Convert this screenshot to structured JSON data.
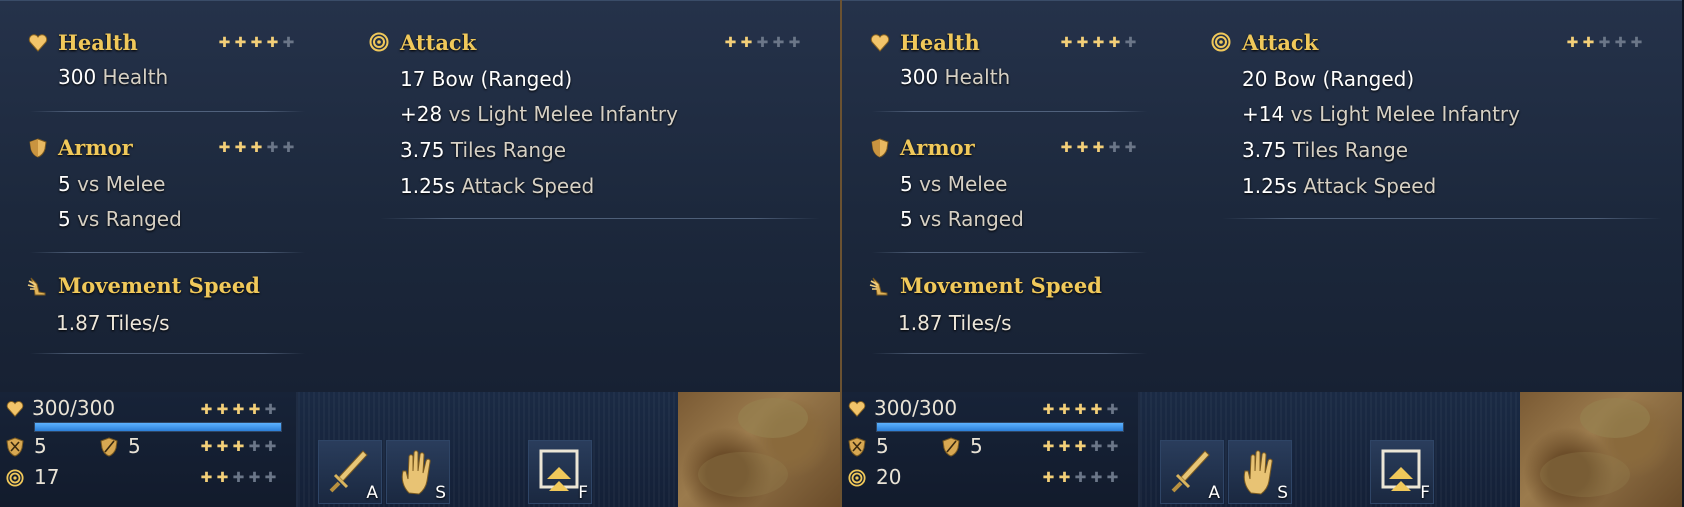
{
  "left": {
    "tooltip": {
      "health": {
        "title": "Health",
        "value": "300",
        "label": "Health",
        "rating": 4
      },
      "armor": {
        "title": "Armor",
        "rating": 3,
        "melee_value": "5",
        "melee_label": "vs Melee",
        "ranged_value": "5",
        "ranged_label": "vs Ranged"
      },
      "movement": {
        "title": "Movement Speed",
        "value": "1.87 Tiles/s"
      },
      "attack": {
        "title": "Attack",
        "rating": 2,
        "lines": [
          {
            "value": "17 Bow (Ranged)",
            "label": ""
          },
          {
            "value": "+28",
            "label": "vs Light Melee Infantry"
          },
          {
            "value": "3.75",
            "label": "Tiles Range"
          },
          {
            "value": "1.25s",
            "label": "Attack Speed"
          }
        ]
      }
    },
    "bottom": {
      "hp": "300/300",
      "hp_fraction": 1.0,
      "hp_rating": 4,
      "armor_melee": "5",
      "armor_ranged": "5",
      "armor_rating": 3,
      "attack": "17",
      "attack_rating": 2,
      "commands": [
        {
          "key": "A",
          "icon": "sword-icon"
        },
        {
          "key": "S",
          "icon": "hand-icon"
        },
        {
          "key": "F",
          "icon": "formation-icon"
        }
      ]
    }
  },
  "right": {
    "tooltip": {
      "health": {
        "title": "Health",
        "value": "300",
        "label": "Health",
        "rating": 4
      },
      "armor": {
        "title": "Armor",
        "rating": 3,
        "melee_value": "5",
        "melee_label": "vs Melee",
        "ranged_value": "5",
        "ranged_label": "vs Ranged"
      },
      "movement": {
        "title": "Movement Speed",
        "value": "1.87 Tiles/s"
      },
      "attack": {
        "title": "Attack",
        "rating": 2,
        "lines": [
          {
            "value": "20 Bow (Ranged)",
            "label": ""
          },
          {
            "value": "+14",
            "label": "vs Light Melee Infantry"
          },
          {
            "value": "3.75",
            "label": "Tiles Range"
          },
          {
            "value": "1.25s",
            "label": "Attack Speed"
          }
        ]
      }
    },
    "bottom": {
      "hp": "300/300",
      "hp_fraction": 1.0,
      "hp_rating": 4,
      "armor_melee": "5",
      "armor_ranged": "5",
      "armor_rating": 3,
      "attack": "20",
      "attack_rating": 2,
      "commands": [
        {
          "key": "A",
          "icon": "sword-icon"
        },
        {
          "key": "S",
          "icon": "hand-icon"
        },
        {
          "key": "F",
          "icon": "formation-icon"
        }
      ]
    }
  },
  "colors": {
    "gold": "#f0c85a",
    "pip_on": "#f3cf78",
    "pip_off": "#6b7688",
    "hp_bar": "#3a8ee8"
  }
}
